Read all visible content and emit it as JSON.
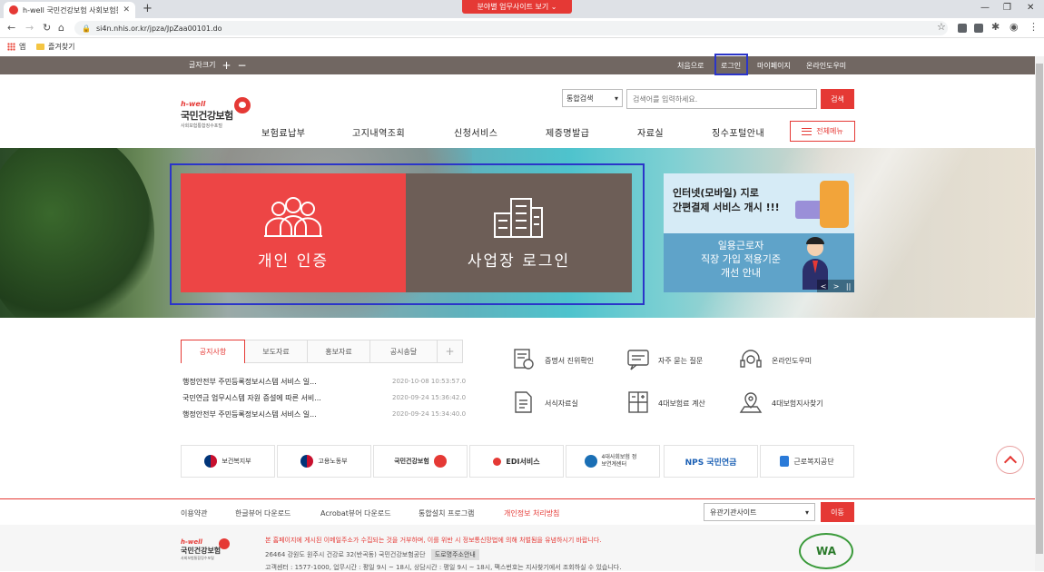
{
  "browser": {
    "tab_title": "h-well 국민건강보험 사회보험통",
    "url": "si4n.nhis.or.kr/jpza/JpZaa00101.do",
    "bookmarks": [
      "앱",
      "즐겨찾기"
    ]
  },
  "utility": {
    "font_size_label": "글자크기",
    "plus": "+",
    "minus": "−",
    "site_select": "분야별 업무사이트 보기",
    "links": [
      "처음으로",
      "로그인",
      "마이페이지",
      "온라인도우미"
    ]
  },
  "logo": {
    "hwell": "h-well",
    "name": "국민건강보험",
    "sub": "사회보험통합징수포털"
  },
  "search": {
    "category": "통합검색",
    "placeholder": "검색어를 입력하세요.",
    "button": "검색"
  },
  "gnb": [
    "보험료납부",
    "고지내역조회",
    "신청서비스",
    "제증명발급",
    "자료실",
    "징수포털안내"
  ],
  "all_menu": "전체메뉴",
  "hero": {
    "personal": "개인 인증",
    "business": "사업장 로그인",
    "banner_top": [
      "인터넷(모바일) 지로",
      "간편결제 서비스 개시 !!!"
    ],
    "banner_bottom": [
      "일용근로자",
      "직장 가입 적용기준",
      "개선 안내"
    ],
    "controls": [
      "<",
      ">",
      "||"
    ]
  },
  "tabs": [
    "공지사항",
    "보도자료",
    "홍보자료",
    "공시송달",
    "+"
  ],
  "notices": [
    {
      "title": "행정안전부 주민등록정보시스템 서비스 일...",
      "date": "2020-10-08 10:53:57.0"
    },
    {
      "title": "국민연금 업무시스템 자원 증설에 따른 서비...",
      "date": "2020-09-24 15:36:42.0"
    },
    {
      "title": "행정안전부 주민등록정보시스템 서비스 일...",
      "date": "2020-09-24 15:34:40.0"
    }
  ],
  "quick": [
    "증명서 진위확인",
    "자주 묻는 질문",
    "온라인도우미",
    "서식자료실",
    "4대보험료 계산",
    "4대보험지사찾기"
  ],
  "partners": [
    "보건복지부",
    "고용노동부",
    "국민건강보험",
    "EDI서비스",
    "4대사회보험 정보연계센터",
    "NPS 국민연금",
    "근로복지공단"
  ],
  "footer": {
    "links": [
      "이용약관",
      "한글뷰어 다운로드",
      "Acrobat뷰어 다운로드",
      "통합설치 프로그램",
      "개인정보 처리방침"
    ],
    "related": "유관기관사이트",
    "go": "이동",
    "notice": "본 홈페이지에 게시된 이메일주소가 수집되는 것을 거부하며, 이를 위반 시 정보통신망법에 의해 처벌됨을 유념하시기 바랍니다.",
    "address": "26464 강원도 원주시 건강로 32(반곡동) 국민건강보험공단",
    "road": "도로명주소안내",
    "contact": "고객센터 : 1577-1000, 업무시간 : 평일 9시 ~ 18시, 상담시간 : 평일 9시 ~ 18시, 팩스번호는 지사찾기에서 조회하실 수 있습니다.",
    "wa": "WA"
  }
}
